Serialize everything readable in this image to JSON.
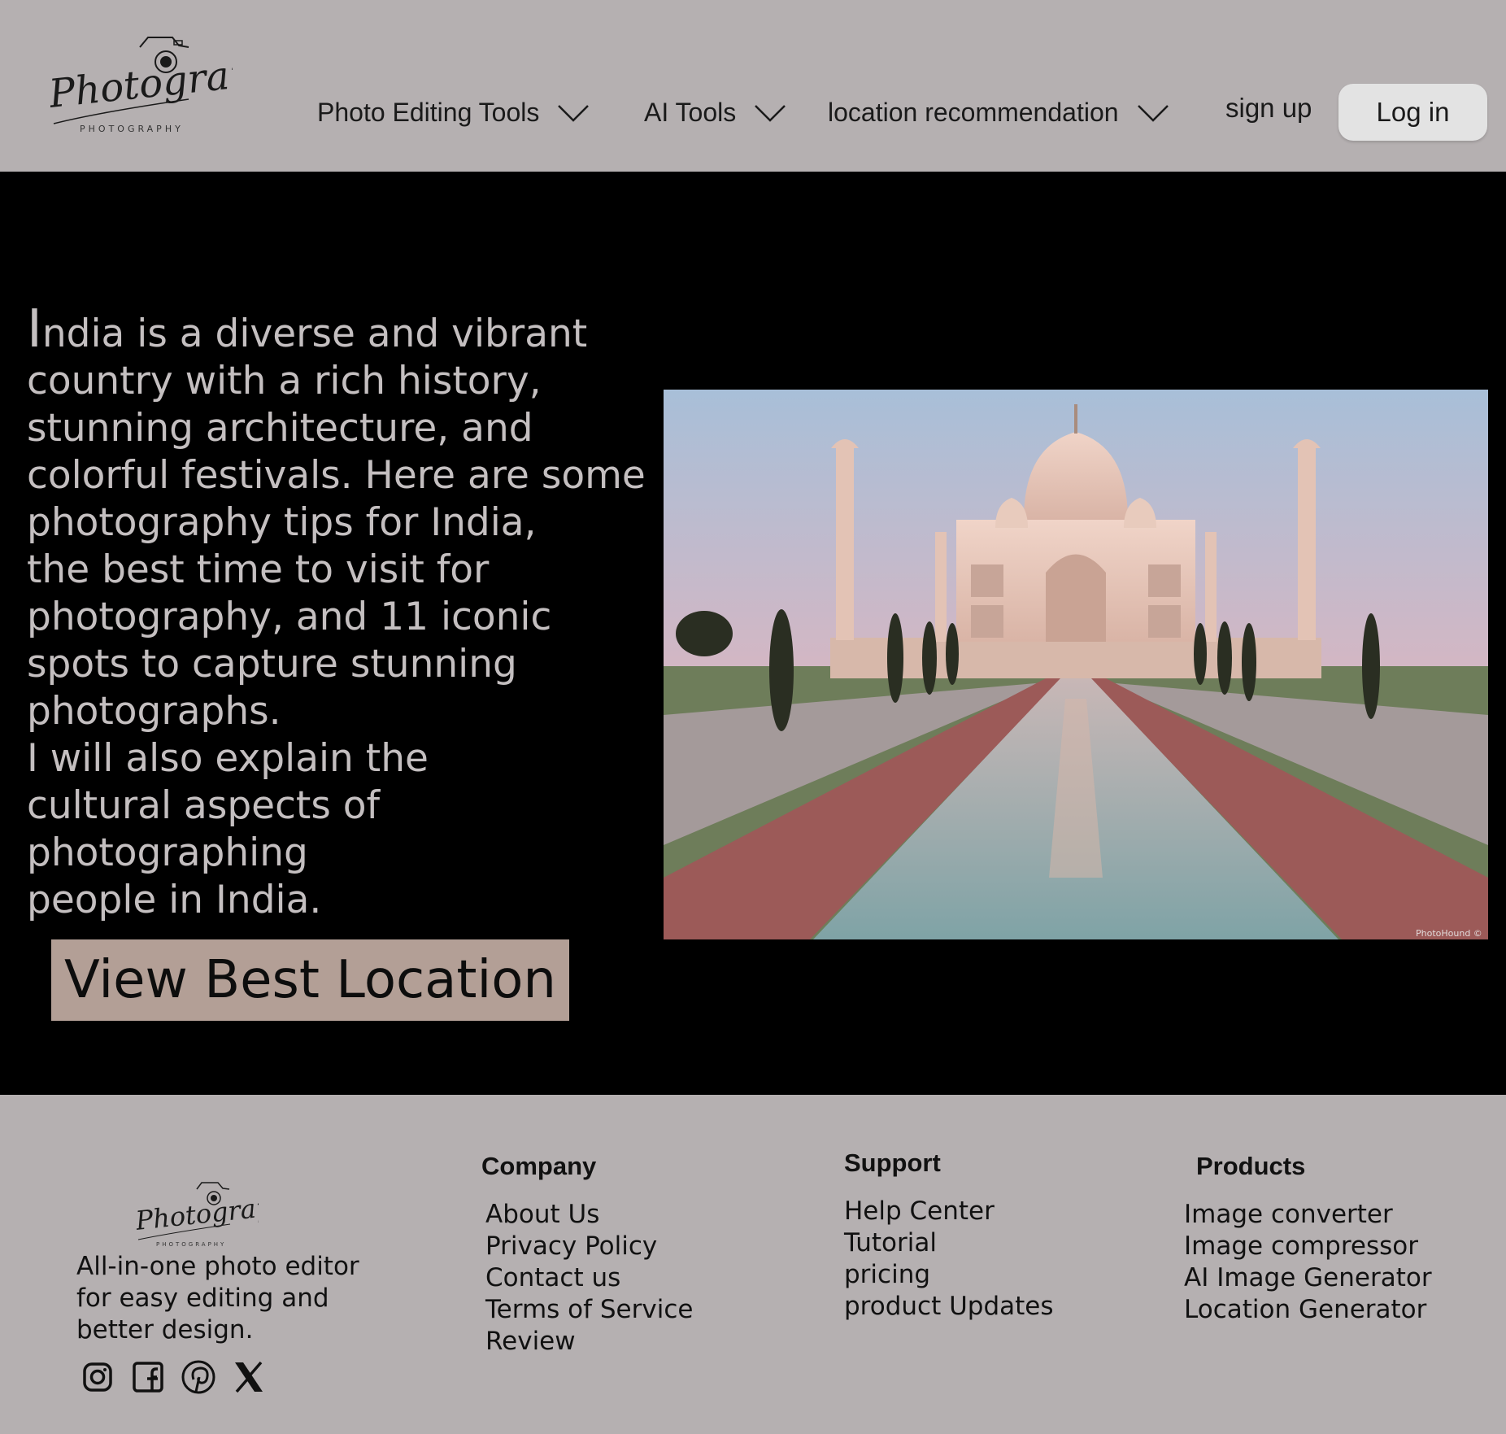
{
  "brand": {
    "logo_text": "Photography",
    "logo_subtext": "PHOTOGRAPHY"
  },
  "nav": {
    "items": [
      {
        "label": "Photo Editing Tools"
      },
      {
        "label": "AI Tools"
      },
      {
        "label": "location recommendation"
      }
    ],
    "signup_label": "sign up",
    "login_label": "Log in"
  },
  "hero": {
    "dropcap": "I",
    "text": "ndia is a diverse and vibrant\ncountry with a rich history,\nstunning architecture, and\ncolorful festivals. Here are some\nphotography tips for India,\nthe best time to visit for\nphotography, and 11 iconic\nspots to capture stunning\nphotographs.\nI will also explain the\ncultural aspects of photographing\npeople in India.",
    "cta_label": "View Best Location",
    "image_watermark": "PhotoHound ©"
  },
  "footer": {
    "tagline": "All-in-one photo editor\nfor easy editing and\nbetter design.",
    "social_icons": [
      "instagram-icon",
      "facebook-icon",
      "pinterest-icon",
      "x-icon"
    ],
    "columns": [
      {
        "heading": "Company",
        "links": [
          "About Us",
          "Privacy Policy",
          "Contact us",
          "Terms of Service",
          "Review"
        ]
      },
      {
        "heading": "Support",
        "links": [
          "Help Center",
          "Tutorial",
          "pricing",
          "product Updates"
        ]
      },
      {
        "heading": "Products",
        "links": [
          "Image converter",
          "Image compressor",
          "AI Image Generator",
          "Location Generator"
        ]
      }
    ]
  },
  "colors": {
    "header_bg": "#b5b0b1",
    "hero_bg": "#000000",
    "hero_text": "#c4bfc0",
    "cta_bg": "#b39f96",
    "login_bg": "#e3e3e3"
  }
}
